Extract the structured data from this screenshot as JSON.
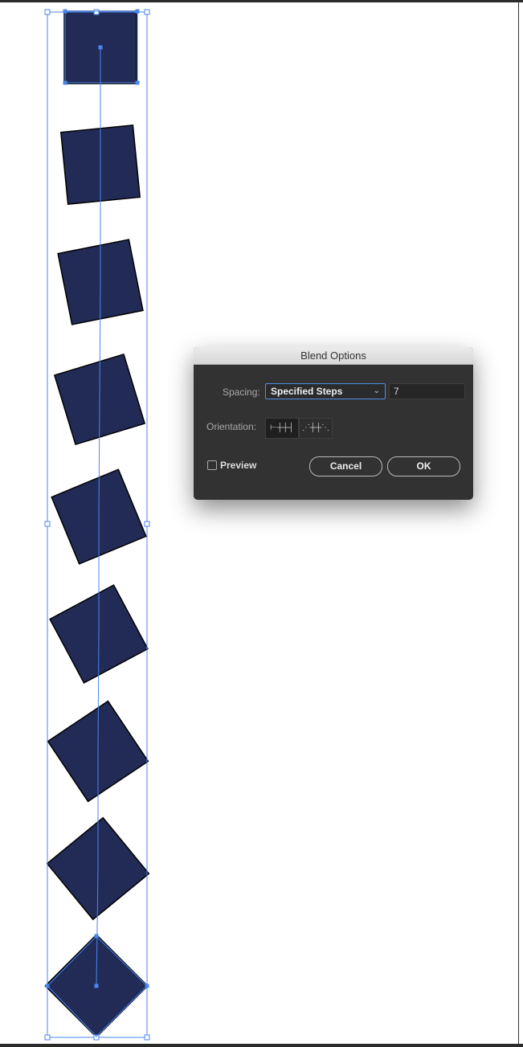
{
  "dialog": {
    "title": "Blend Options",
    "spacing_label": "Spacing:",
    "spacing_value": "Specified Steps",
    "steps_value": "7",
    "orientation_label": "Orientation:",
    "orientation_options": [
      {
        "name": "align-to-page",
        "glyph": "⊢┼┼┤",
        "selected": true
      },
      {
        "name": "align-to-path",
        "glyph": "⋰┼┼⋱",
        "selected": false
      }
    ],
    "preview_label": "Preview",
    "preview_checked": false,
    "cancel_label": "Cancel",
    "ok_label": "OK"
  },
  "artwork": {
    "fill_color": "#222b55",
    "selection_color": "#4a86f0",
    "blend_objects": 9,
    "rotation_start_deg": 0,
    "rotation_end_deg": 45
  }
}
